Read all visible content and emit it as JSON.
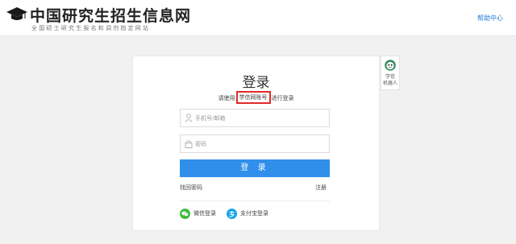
{
  "header": {
    "site_title": "中国研究生招生信息网",
    "site_subtitle": "全国硕士研究生报名和调剂指定网站",
    "help_link": "帮助中心"
  },
  "login": {
    "title": "登录",
    "subtitle_prefix": "请使用",
    "subtitle_highlight": "学信网账号",
    "subtitle_suffix": "进行登录",
    "username_placeholder": "手机号/邮箱",
    "password_placeholder": "密码",
    "login_button": "登 录",
    "forgot_password": "找回密码",
    "register": "注册",
    "wechat_login": "微信登录",
    "alipay_login": "支付宝登录"
  },
  "robot": {
    "label_line1": "学信",
    "label_line2": "机器人"
  },
  "colors": {
    "accent": "#2f8fea",
    "highlight_border": "#e02a2a",
    "wechat": "#3dbb3d",
    "alipay": "#1aa3e8"
  }
}
